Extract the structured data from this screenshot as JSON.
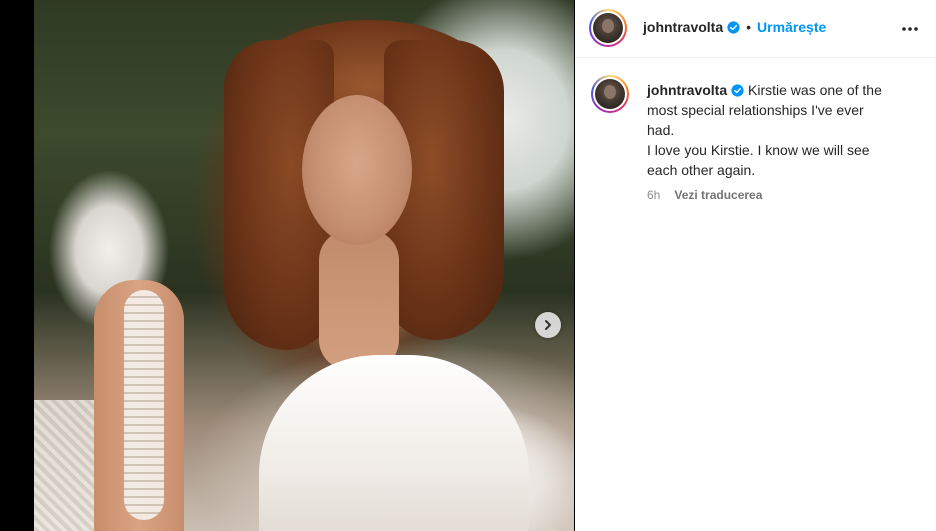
{
  "post": {
    "username": "johntravolta",
    "follow_label": "Urmărește",
    "separator": "•",
    "caption_lines": [
      "Kirstie was one of the",
      "most special relationships I've ever",
      "had.",
      "I love you Kirstie. I know we will see",
      "each other again."
    ],
    "time_ago": "6h",
    "translate_label": "Vezi traducerea"
  },
  "colors": {
    "accent": "#0095f6",
    "verified": "#0095f6",
    "text": "#262626",
    "secondary": "#8e8e8e"
  },
  "icons": {
    "verified": "verified-badge-icon",
    "more": "more-options-icon",
    "next": "chevron-right-icon"
  }
}
